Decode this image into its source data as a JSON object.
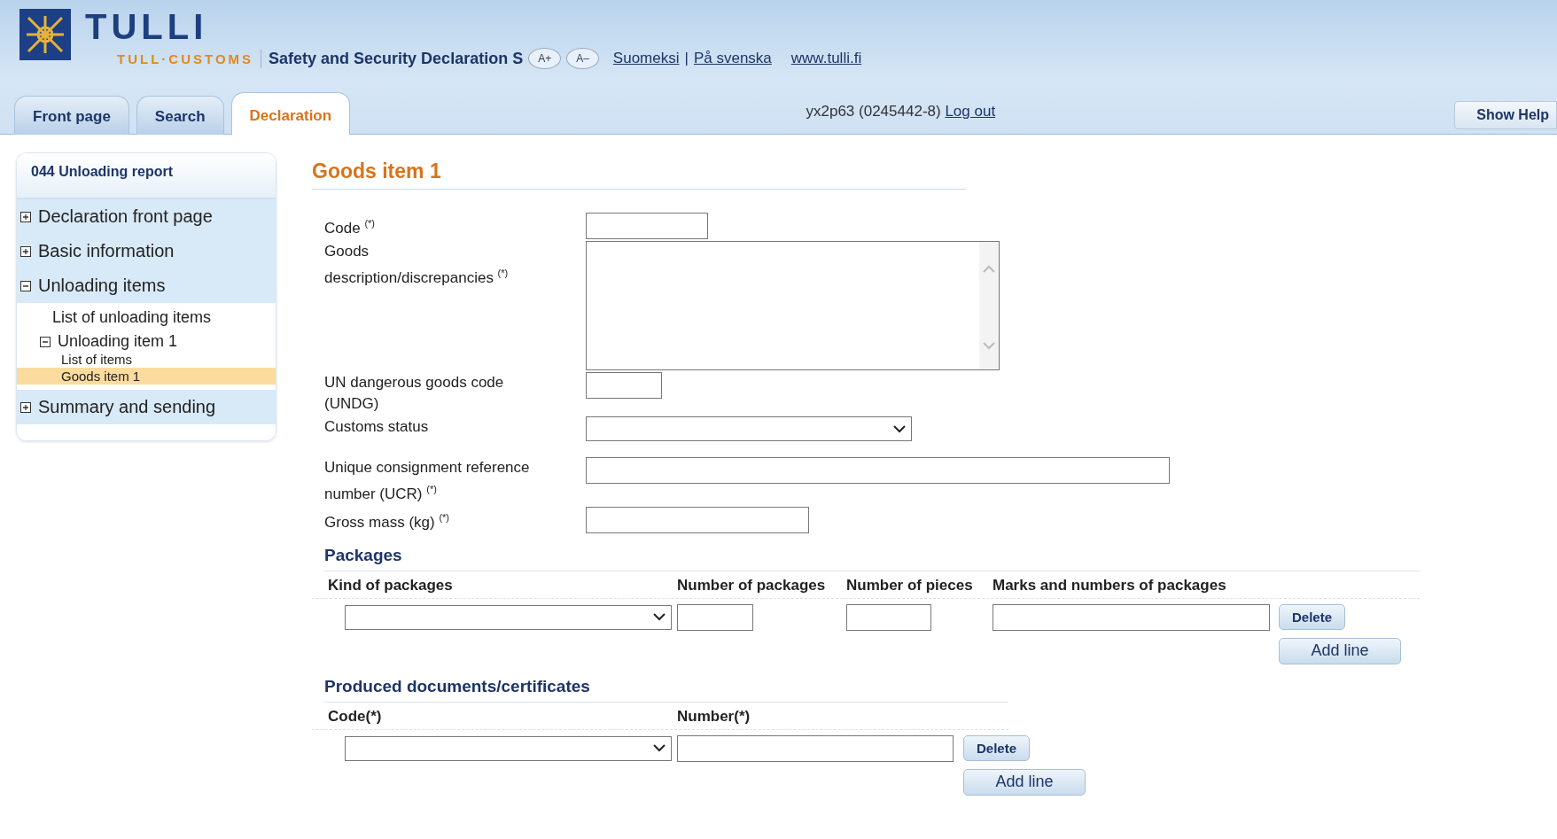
{
  "header": {
    "brand": "TULLI",
    "brand_sub": "TULL·CUSTOMS",
    "service_title": "Safety and Security Declaration S",
    "font_buttons": [
      "A+",
      "A–"
    ],
    "language_links": [
      "Suomeksi",
      "På svenska"
    ],
    "link_separator": "|",
    "site_link": "www.tulli.fi",
    "user": "yx2p63 (0245442-8)",
    "logout": "Log out",
    "help_button": "Show Help"
  },
  "tabs": [
    {
      "label": "Front page",
      "selected": false
    },
    {
      "label": "Search",
      "selected": false
    },
    {
      "label": "Declaration",
      "selected": true
    }
  ],
  "sidebar": {
    "title": "044 Unloading report",
    "items": [
      {
        "label": "Declaration front page",
        "expanded": false,
        "selected": false
      },
      {
        "label": "Basic information",
        "expanded": false,
        "selected": false
      },
      {
        "label": "Unloading items",
        "expanded": true,
        "selected": false,
        "children": [
          {
            "label": "List of unloading items",
            "selected": false
          },
          {
            "label": "Unloading item 1",
            "expanded": true,
            "selected": false,
            "children": [
              {
                "label": "List of items",
                "selected": false
              },
              {
                "label": "Goods item 1",
                "selected": true
              }
            ]
          }
        ]
      },
      {
        "label": "Summary and sending",
        "expanded": false,
        "selected": false
      }
    ]
  },
  "form": {
    "title": "Goods item 1",
    "fields": [
      {
        "label": "Code $^{(*)}$",
        "kind": "input"
      },
      {
        "label": "Goods description/discrepancies $^{(*)}$",
        "kind": "textarea"
      },
      {
        "label": "UN dangerous goods code (UNDG)",
        "kind": "input"
      },
      {
        "label": "Customs status",
        "kind": "select"
      },
      {
        "label": "Unique consignment reference number (UCR) $^{(*)}$",
        "kind": "input"
      },
      {
        "label": "Gross mass (kg) $^{(*)}$",
        "kind": "input"
      }
    ]
  },
  "packages": {
    "title": "Packages",
    "columns": [
      "Kind of packages",
      "Number of packages",
      "Number of pieces",
      "Marks and numbers of packages"
    ],
    "rows": [
      {
        "delete_button": "Delete"
      }
    ],
    "add_button": "Add line"
  },
  "documents": {
    "title": "Produced documents/certificates",
    "columns": [
      "Code(*)",
      "Number(*)"
    ],
    "rows": [
      {
        "delete_button": "Delete"
      }
    ],
    "add_button": "Add line"
  }
}
